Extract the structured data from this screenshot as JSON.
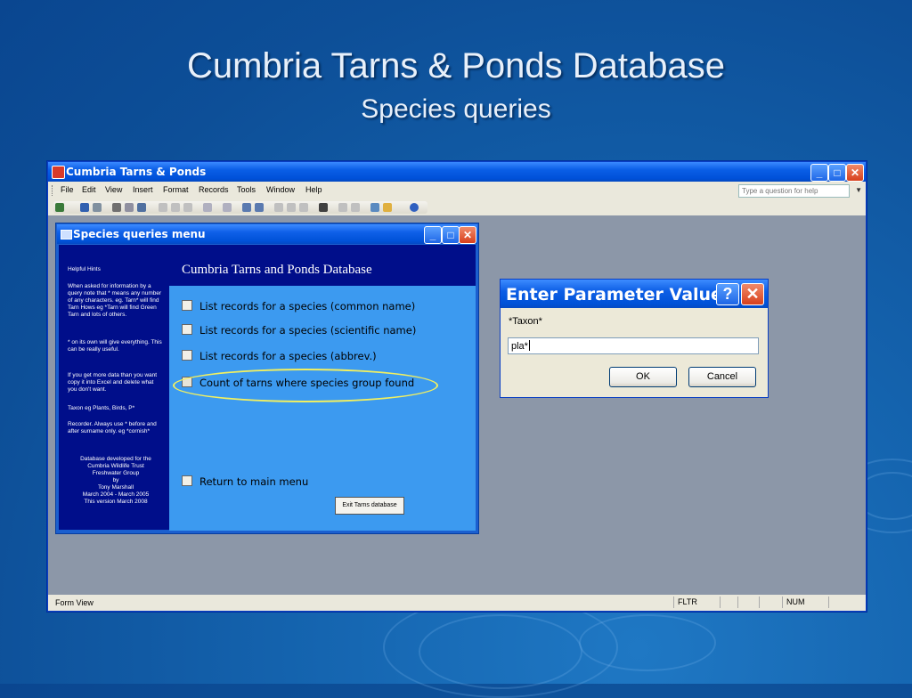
{
  "slide": {
    "title": "Cumbria Tarns & Ponds Database",
    "subtitle": "Species queries"
  },
  "app": {
    "title": "Cumbria Tarns & Ponds",
    "menu": [
      "File",
      "Edit",
      "View",
      "Insert",
      "Format",
      "Records",
      "Tools",
      "Window",
      "Help"
    ],
    "help_placeholder": "Type a question for help",
    "status": {
      "text": "Form View",
      "fltr": "FLTR",
      "num": "NUM"
    }
  },
  "subwindow": {
    "title": "Species queries menu",
    "form_title": "Cumbria Tarns and Ponds Database",
    "options": [
      "List records for a species (common name)",
      "List records for a species (scientific name)",
      "List records for a species (abbrev.)",
      "Count of tarns where species group found",
      "Return to main menu"
    ],
    "exit_button": "Exit Tarns database",
    "hints": {
      "heading": "Helpful Hints",
      "p1": "When asked for information by a query note that * means any number of any characters. eg. Tarn* will find Tarn Hows eg *Tarn will find Green Tarn and lots of others.",
      "p2": "* on its own will give everything. This can be really useful.",
      "p3": "If you get more data than you want copy it into Excel and delete what you don't want.",
      "p4": "Taxon eg Plants, Birds, P*",
      "p5": "Recorder. Always use * before and after surname only. eg *cornish*",
      "credits": [
        "Database developed for the",
        "Cumbria Wildlife Trust",
        "Freshwater Group",
        "by",
        "Tony Marshall",
        "March 2004 - March 2005",
        "This version March 2008"
      ]
    }
  },
  "dialog": {
    "title": "Enter Parameter Value",
    "help_glyph": "?",
    "label": "*Taxon*",
    "value": "pla*",
    "ok": "OK",
    "cancel": "Cancel"
  },
  "colors": {
    "slide_bg": "#1565b0",
    "titlebar": "#0a5ee6",
    "form_blue": "#3c9af0",
    "panel_navy": "#000e8a",
    "highlight": "#f2f060"
  }
}
